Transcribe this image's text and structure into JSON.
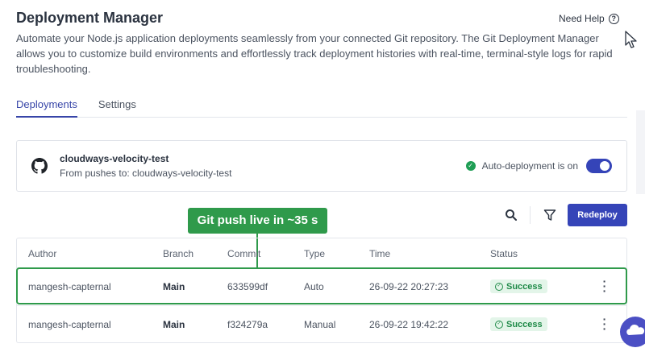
{
  "header": {
    "title": "Deployment Manager",
    "help_label": "Need Help",
    "description": "Automate your Node.js application deployments seamlessly from your connected Git repository. The Git Deployment Manager allows you to customize build environments and effortlessly track deployment histories with real-time, terminal-style logs for rapid troubleshooting."
  },
  "tabs": [
    {
      "label": "Deployments",
      "active": true
    },
    {
      "label": "Settings",
      "active": false
    }
  ],
  "repo": {
    "name": "cloudways-velocity-test",
    "subtitle": "From pushes to: cloudways-velocity-test",
    "auto_deploy_label": "Auto-deployment is on",
    "auto_deploy_on": true
  },
  "toolbar": {
    "redeploy_label": "Redeploy"
  },
  "annotation": {
    "callout_text": "Git push live in ~35 s",
    "color": "#2f9a4b"
  },
  "table": {
    "columns": [
      "Author",
      "Branch",
      "Commit",
      "Type",
      "Time",
      "Status"
    ],
    "rows": [
      {
        "author": "mangesh-capternal",
        "branch": "Main",
        "commit": "633599df",
        "type": "Auto",
        "time": "26-09-22 20:27:23",
        "status": "Success",
        "highlighted": true
      },
      {
        "author": "mangesh-capternal",
        "branch": "Main",
        "commit": "f324279a",
        "type": "Manual",
        "time": "26-09-22 19:42:22",
        "status": "Success",
        "highlighted": false
      }
    ]
  },
  "colors": {
    "accent": "#3544b8",
    "success": "#1f8a48",
    "success_bg": "#e3f5e9"
  },
  "icons": [
    "help-icon",
    "github-icon",
    "check-icon",
    "search-icon",
    "filter-icon",
    "success-check-icon",
    "kebab-menu-icon",
    "mouse-cursor-icon",
    "chat-bubble-icon"
  ]
}
